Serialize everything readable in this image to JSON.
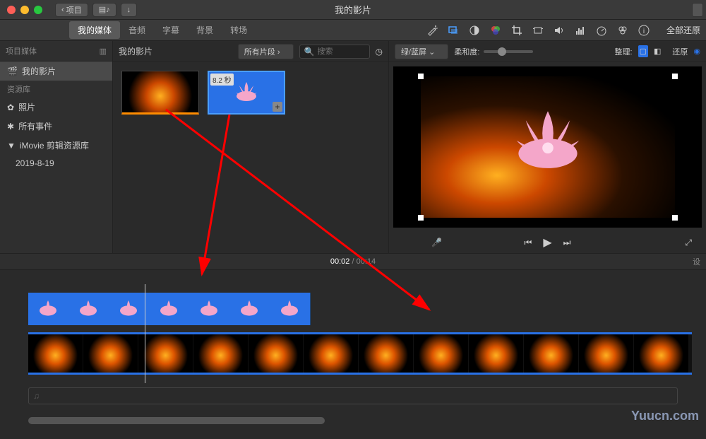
{
  "window": {
    "title": "我的影片",
    "back_label": "项目"
  },
  "main_tabs": {
    "media": "我的媒体",
    "audio": "音频",
    "subtitle": "字幕",
    "background": "背景",
    "transition": "转场"
  },
  "toolbar": {
    "reset_all": "全部还原"
  },
  "sidebar": {
    "header": "项目媒体",
    "project": "我的影片",
    "library_header": "资源库",
    "photos": "照片",
    "all_events": "所有事件",
    "imovie_lib": "iMovie 剪辑资源库",
    "date_event": "2019-8-19"
  },
  "browser": {
    "title": "我的影片",
    "filter": "所有片段",
    "search_placeholder": "搜索",
    "clip_duration": "8.2 秒"
  },
  "preview": {
    "effect": "绿/蓝屏",
    "softness_label": "柔和度:",
    "arrange_label": "整理:",
    "reset": "还原"
  },
  "timeline": {
    "current": "00:02",
    "total": "00:14",
    "settings": "设"
  },
  "watermark": "Yuucn.com"
}
